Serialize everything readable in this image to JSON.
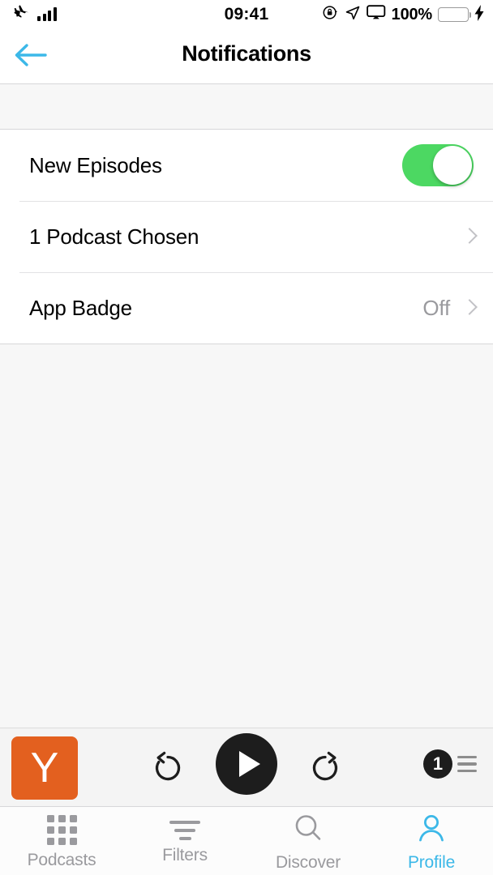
{
  "status_bar": {
    "airplane_icon": "airplane-icon",
    "signal_icon": "signal-bars-icon",
    "time": "09:41",
    "rotation_lock_icon": "rotation-lock-icon",
    "location_icon": "location-arrow-icon",
    "airplay_icon": "airplay-screen-icon",
    "battery_percent": "100%",
    "battery_icon": "battery-icon",
    "charging_icon": "lightning-bolt-icon",
    "battery_color": "#4cd964"
  },
  "nav": {
    "back_icon": "back-arrow-icon",
    "back_color": "#3cb8e8",
    "title": "Notifications"
  },
  "settings": {
    "rows": [
      {
        "label": "New Episodes",
        "control": "toggle",
        "toggle_on": true,
        "toggle_color": "#4cd862",
        "value": ""
      },
      {
        "label": "1 Podcast Chosen",
        "control": "chevron",
        "value": ""
      },
      {
        "label": "App Badge",
        "control": "chevron",
        "value": "Off"
      }
    ]
  },
  "player": {
    "artwork_letter": "Y",
    "artwork_color": "#e3601f",
    "skip_back_icon": "skip-back-icon",
    "play_icon": "play-icon",
    "skip_forward_icon": "skip-forward-icon",
    "queue_count": "1",
    "queue_icon": "queue-list-icon"
  },
  "tab_bar": {
    "active_color": "#3cb8e8",
    "inactive_color": "#9a9a9e",
    "tabs": [
      {
        "label": "Podcasts",
        "icon": "grid-icon",
        "active": false
      },
      {
        "label": "Filters",
        "icon": "filters-icon",
        "active": false
      },
      {
        "label": "Discover",
        "icon": "search-icon",
        "active": false
      },
      {
        "label": "Profile",
        "icon": "person-icon",
        "active": true
      }
    ]
  }
}
